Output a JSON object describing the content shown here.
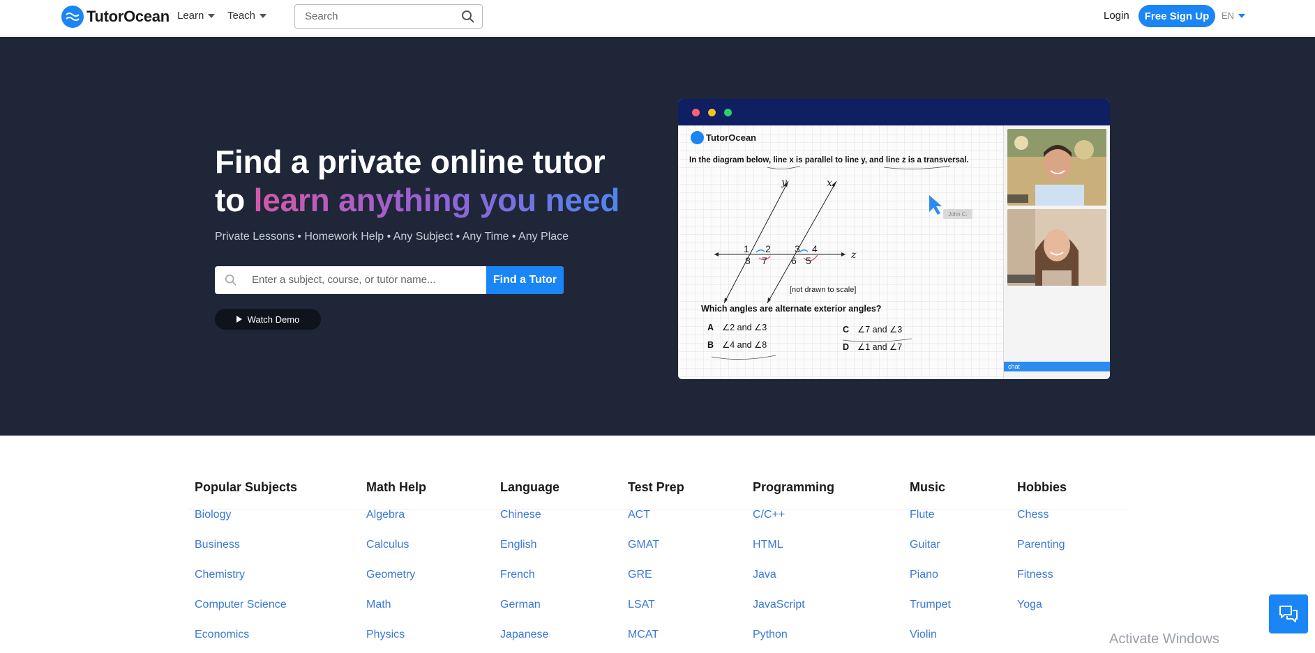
{
  "header": {
    "logo_text": "TutorOcean",
    "menu": [
      {
        "label": "Learn"
      },
      {
        "label": "Teach"
      }
    ],
    "search_placeholder": "Search",
    "login_label": "Login",
    "signup_label": "Free Sign Up",
    "language": "EN"
  },
  "hero": {
    "title_line1": "Find a private online tutor",
    "title_line2_plain": "to ",
    "title_line2_highlight": "learn anything you need",
    "subtitle": "Private Lessons • Homework Help • Any Subject • Any Time • Any Place",
    "search_placeholder": "Enter a subject, course, or tutor name...",
    "find_button": "Find a Tutor",
    "demo_button": "Watch Demo",
    "gradient_colors": [
      "#d25aa8",
      "#9b5fd3",
      "#4e86ee"
    ]
  },
  "illustration": {
    "logo_text": "TutorOcean",
    "question": "In the diagram below, line x is parallel to line y, and line z is a transversal.",
    "cursor_label": "John C.",
    "diagram_labels": {
      "y": "y",
      "x": "x",
      "z": "z",
      "n1": "1",
      "n2": "2",
      "n3": "3",
      "n4": "4",
      "n5": "5",
      "n6": "6",
      "n7": "7",
      "n8": "8"
    },
    "scale_note": "[not drawn to scale]",
    "question2": "Which angles are alternate exterior angles?",
    "options": [
      {
        "letter": "A",
        "text": "∠2  and ∠3"
      },
      {
        "letter": "B",
        "text": "∠4  and ∠8"
      },
      {
        "letter": "C",
        "text": "∠7  and ∠3"
      },
      {
        "letter": "D",
        "text": "∠1  and ∠7"
      }
    ],
    "chat_label": "chat"
  },
  "subjects": {
    "columns": [
      {
        "heading": "Popular Subjects",
        "items": [
          "Biology",
          "Business",
          "Chemistry",
          "Computer Science",
          "Economics"
        ]
      },
      {
        "heading": "Math Help",
        "items": [
          "Algebra",
          "Calculus",
          "Geometry",
          "Math",
          "Physics"
        ]
      },
      {
        "heading": "Language",
        "items": [
          "Chinese",
          "English",
          "French",
          "German",
          "Japanese"
        ]
      },
      {
        "heading": "Test Prep",
        "items": [
          "ACT",
          "GMAT",
          "GRE",
          "LSAT",
          "MCAT"
        ]
      },
      {
        "heading": "Programming",
        "items": [
          "C/C++",
          "HTML",
          "Java",
          "JavaScript",
          "Python"
        ]
      },
      {
        "heading": "Music",
        "items": [
          "Flute",
          "Guitar",
          "Piano",
          "Trumpet",
          "Violin"
        ]
      },
      {
        "heading": "Hobbies",
        "items": [
          "Chess",
          "Parenting",
          "Fitness",
          "Yoga"
        ]
      }
    ]
  },
  "overlay": {
    "watermark": "Activate Windows"
  },
  "colors": {
    "brand_blue": "#1a85f5",
    "hero_bg": "#1e2638",
    "link_blue": "#3b78d8"
  }
}
